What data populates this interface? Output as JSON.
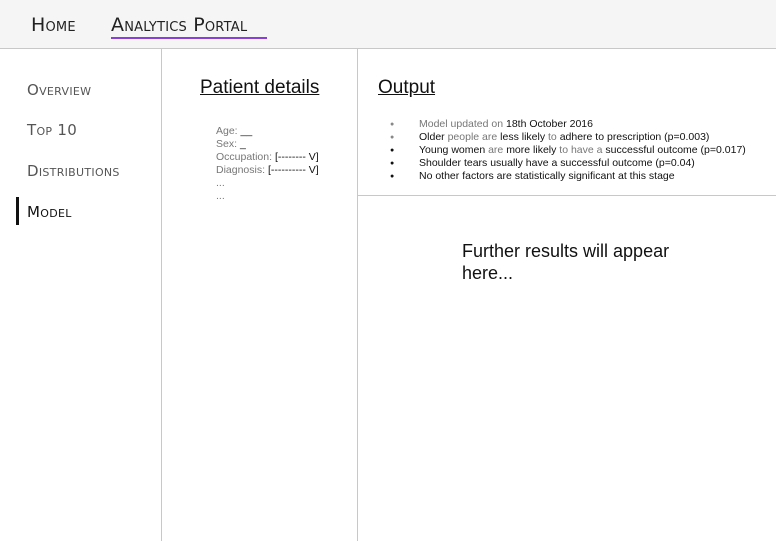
{
  "nav": {
    "home": "Home",
    "portal": "Analytics Portal",
    "active_color": "#8a3fd6"
  },
  "sidebar": {
    "items": [
      {
        "label": "Overview"
      },
      {
        "label": "Top 10"
      },
      {
        "label": "Distributions"
      },
      {
        "label": "Model",
        "active": true
      }
    ]
  },
  "patient": {
    "title": "Patient details",
    "fields": {
      "age_label": "Age:",
      "age_value": "__",
      "sex_label": "Sex:",
      "sex_value": "_",
      "occupation_label": "Occupation:",
      "occupation_value": "[--------  V]",
      "diagnosis_label": "Diagnosis:",
      "diagnosis_value": "[---------- V]",
      "ellipsis1": "...",
      "ellipsis2": "..."
    }
  },
  "output": {
    "title": "Output",
    "b1": {
      "prefix": "Model updated on ",
      "date": "18th October 2016"
    },
    "b2": {
      "t1": "Older ",
      "t2": "people are ",
      "t3": "less likely ",
      "t4": "to ",
      "t5": "adhere to prescription (p=0.003)"
    },
    "b3": {
      "t1": "Young women ",
      "t2": "are ",
      "t3": "more likely ",
      "t4": "to have a ",
      "t5": "successful outcome (p=0.017)"
    },
    "b4": "Shoulder tears usually have a successful outcome (p=0.04)",
    "b5": "No other factors are statistically significant at this stage"
  },
  "further": "Further results will appear here..."
}
